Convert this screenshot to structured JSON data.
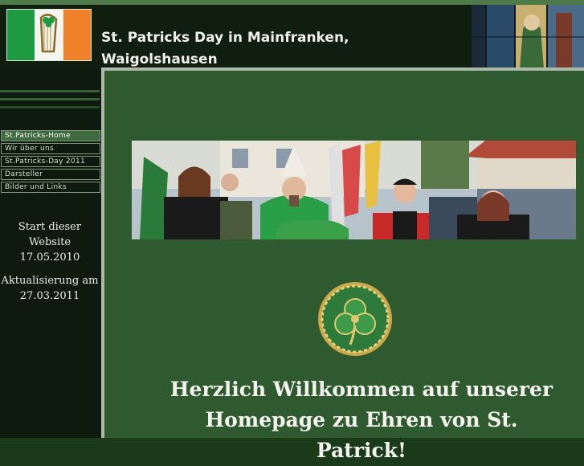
{
  "header": {
    "title_line1": "St. Patricks Day in Mainfranken,",
    "title_line2": "Waigolshausen"
  },
  "menu": [
    {
      "label": "St.Patricks-Home",
      "active": true
    },
    {
      "label": "Wir über uns",
      "active": false
    },
    {
      "label": "St.Patricks-Day 2011",
      "active": false
    },
    {
      "label": "Darsteller",
      "active": false
    },
    {
      "label": "Bilder und Links",
      "active": false
    }
  ],
  "sidebar": {
    "start_label": "Start dieser Website",
    "start_date": "17.05.2010",
    "update_label": "Aktualisierung am",
    "update_date": "27.03.2011"
  },
  "main": {
    "welcome_line1": "Herzlich Willkommen auf unserer",
    "welcome_line2": "Homepage zu Ehren von St. Patrick!"
  },
  "colors": {
    "background": "#2f5a2f",
    "sidebar": "#0d1a0d",
    "header": "#0f1e0f",
    "menu_active": "#3f6a3f",
    "flag_green": "#1e9a43",
    "flag_orange": "#f0802a"
  },
  "icons": {
    "flag": "irish-flag-with-harp",
    "emblem": "celtic-shamrock-emblem"
  }
}
